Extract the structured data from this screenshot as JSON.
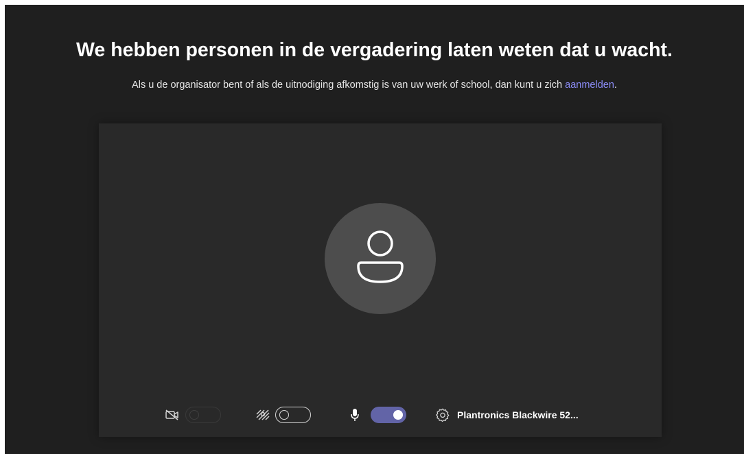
{
  "header": {
    "title": "We hebben personen in de vergadering laten weten dat u wacht.",
    "subtitle": "Als u de organisator bent of als de uitnodiging afkomstig is van uw werk of school, dan kunt u zich",
    "signin_link": "aanmelden",
    "subtitle_end": "."
  },
  "controls": {
    "camera": {
      "icon": "camera-off-icon",
      "state": "off",
      "enabled": false
    },
    "background_effects": {
      "icon": "background-blur-icon",
      "state": "off"
    },
    "microphone": {
      "icon": "microphone-icon",
      "state": "on"
    },
    "device_settings": {
      "icon": "gear-icon",
      "label": "Plantronics Blackwire 52..."
    }
  },
  "colors": {
    "background": "#1f1f1f",
    "preview": "#292929",
    "avatar": "#4d4d4d",
    "accent": "#6264a7",
    "link": "#8b8cf7"
  }
}
